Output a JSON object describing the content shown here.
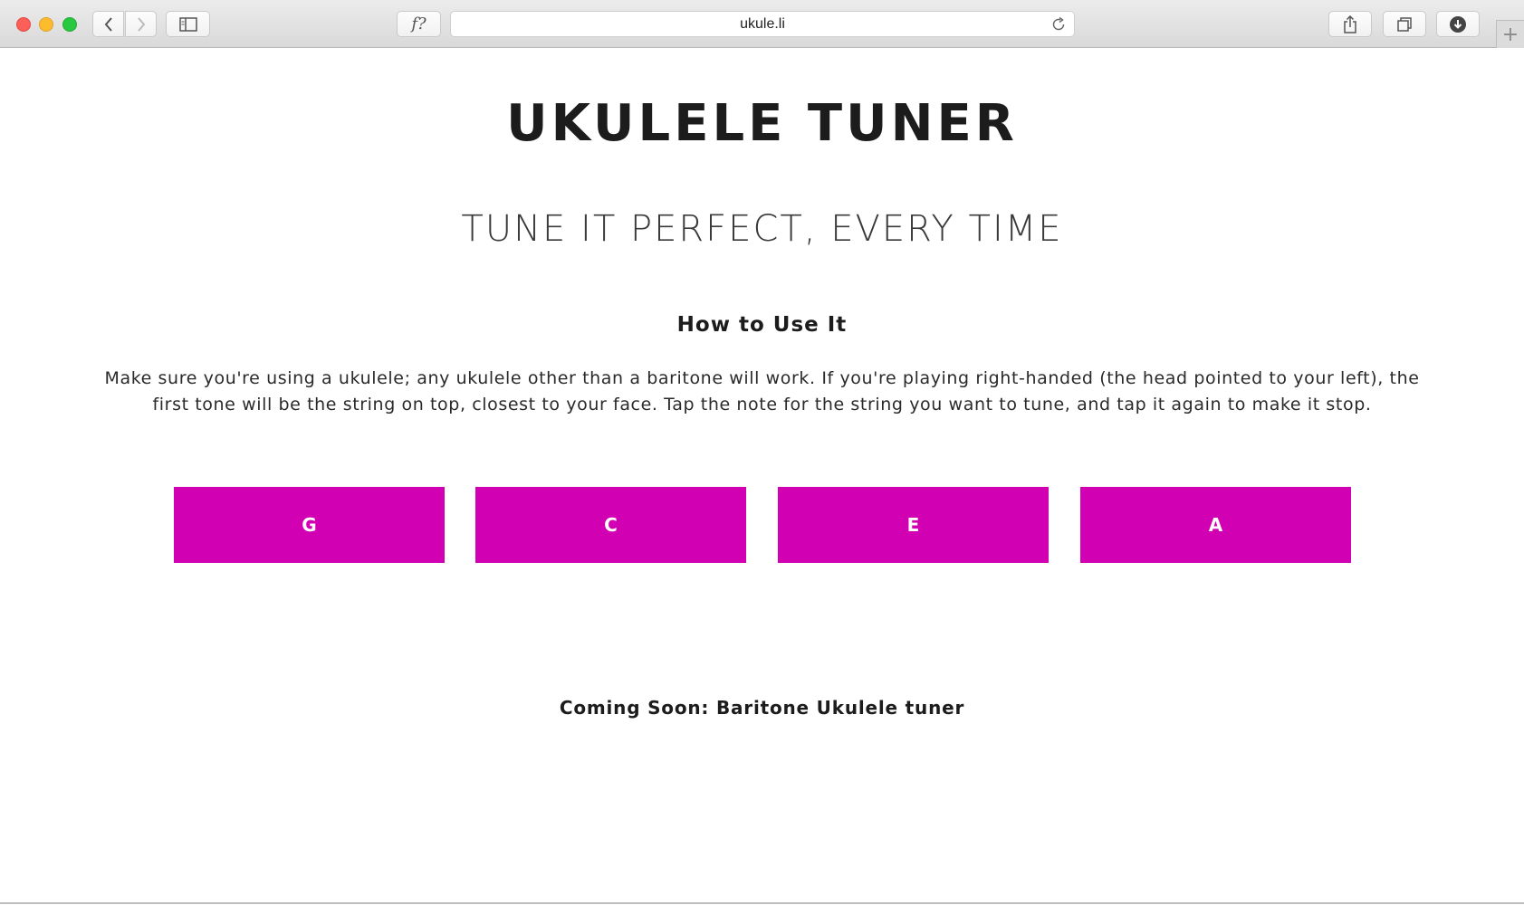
{
  "browser": {
    "url": "ukule.li",
    "font_button_label": "f?",
    "new_tab_label": "+",
    "icons": {
      "back": "chevron-left-icon",
      "forward": "chevron-right-icon",
      "sidebar": "sidebar-icon",
      "reload": "reload-icon",
      "share": "share-icon",
      "tabs": "tabs-overview-icon",
      "download": "download-icon"
    }
  },
  "page": {
    "title": "UKULELE TUNER",
    "subtitle": "TUNE IT PERFECT, EVERY TIME",
    "howto_heading": "How to Use It",
    "instructions": "Make sure you're using a ukulele; any ukulele other than a baritone will work. If you're playing right-handed (the head pointed to your left), the first tone will be the string on top, closest to your face. Tap the note for the string you want to tune, and tap it again to make it stop.",
    "notes": [
      {
        "label": "G"
      },
      {
        "label": "C"
      },
      {
        "label": "E"
      },
      {
        "label": "A"
      }
    ],
    "coming_soon": "Coming Soon: Baritone Ukulele tuner"
  },
  "colors": {
    "note_button": "#d100b2",
    "note_text": "#ffffff",
    "text": "#1c1c1c"
  }
}
